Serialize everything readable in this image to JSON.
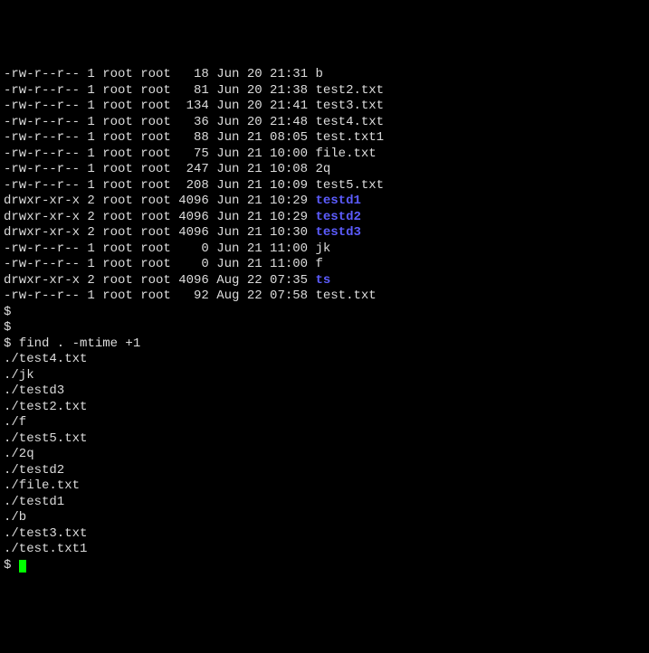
{
  "ls_rows": [
    {
      "perm": "-rw-r--r--",
      "links": "1",
      "owner": "root",
      "group": "root",
      "size": "  18",
      "month": "Jun",
      "day": "20",
      "time": "21:31",
      "name": "b",
      "is_dir": false
    },
    {
      "perm": "-rw-r--r--",
      "links": "1",
      "owner": "root",
      "group": "root",
      "size": "  81",
      "month": "Jun",
      "day": "20",
      "time": "21:38",
      "name": "test2.txt",
      "is_dir": false
    },
    {
      "perm": "-rw-r--r--",
      "links": "1",
      "owner": "root",
      "group": "root",
      "size": " 134",
      "month": "Jun",
      "day": "20",
      "time": "21:41",
      "name": "test3.txt",
      "is_dir": false
    },
    {
      "perm": "-rw-r--r--",
      "links": "1",
      "owner": "root",
      "group": "root",
      "size": "  36",
      "month": "Jun",
      "day": "20",
      "time": "21:48",
      "name": "test4.txt",
      "is_dir": false
    },
    {
      "perm": "-rw-r--r--",
      "links": "1",
      "owner": "root",
      "group": "root",
      "size": "  88",
      "month": "Jun",
      "day": "21",
      "time": "08:05",
      "name": "test.txt1",
      "is_dir": false
    },
    {
      "perm": "-rw-r--r--",
      "links": "1",
      "owner": "root",
      "group": "root",
      "size": "  75",
      "month": "Jun",
      "day": "21",
      "time": "10:00",
      "name": "file.txt",
      "is_dir": false
    },
    {
      "perm": "-rw-r--r--",
      "links": "1",
      "owner": "root",
      "group": "root",
      "size": " 247",
      "month": "Jun",
      "day": "21",
      "time": "10:08",
      "name": "2q",
      "is_dir": false
    },
    {
      "perm": "-rw-r--r--",
      "links": "1",
      "owner": "root",
      "group": "root",
      "size": " 208",
      "month": "Jun",
      "day": "21",
      "time": "10:09",
      "name": "test5.txt",
      "is_dir": false
    },
    {
      "perm": "drwxr-xr-x",
      "links": "2",
      "owner": "root",
      "group": "root",
      "size": "4096",
      "month": "Jun",
      "day": "21",
      "time": "10:29",
      "name": "testd1",
      "is_dir": true
    },
    {
      "perm": "drwxr-xr-x",
      "links": "2",
      "owner": "root",
      "group": "root",
      "size": "4096",
      "month": "Jun",
      "day": "21",
      "time": "10:29",
      "name": "testd2",
      "is_dir": true
    },
    {
      "perm": "drwxr-xr-x",
      "links": "2",
      "owner": "root",
      "group": "root",
      "size": "4096",
      "month": "Jun",
      "day": "21",
      "time": "10:30",
      "name": "testd3",
      "is_dir": true
    },
    {
      "perm": "-rw-r--r--",
      "links": "1",
      "owner": "root",
      "group": "root",
      "size": "   0",
      "month": "Jun",
      "day": "21",
      "time": "11:00",
      "name": "jk",
      "is_dir": false
    },
    {
      "perm": "-rw-r--r--",
      "links": "1",
      "owner": "root",
      "group": "root",
      "size": "   0",
      "month": "Jun",
      "day": "21",
      "time": "11:00",
      "name": "f",
      "is_dir": false
    },
    {
      "perm": "drwxr-xr-x",
      "links": "2",
      "owner": "root",
      "group": "root",
      "size": "4096",
      "month": "Aug",
      "day": "22",
      "time": "07:35",
      "name": "ts",
      "is_dir": true
    },
    {
      "perm": "-rw-r--r--",
      "links": "1",
      "owner": "root",
      "group": "root",
      "size": "  92",
      "month": "Aug",
      "day": "22",
      "time": "07:58",
      "name": "test.txt",
      "is_dir": false
    }
  ],
  "prompt": "$",
  "empty_prompts": [
    "$",
    "$"
  ],
  "command_line": "$ find . -mtime +1",
  "find_output": [
    "./test4.txt",
    "./jk",
    "./testd3",
    "./test2.txt",
    "./f",
    "./test5.txt",
    "./2q",
    "./testd2",
    "./file.txt",
    "./testd1",
    "./b",
    "./test3.txt",
    "./test.txt1"
  ],
  "cursor_prompt": "$ "
}
